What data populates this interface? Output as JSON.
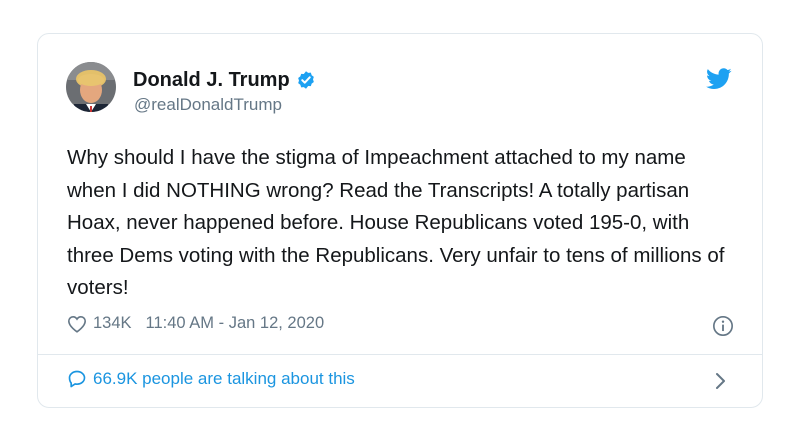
{
  "author": {
    "name": "Donald J. Trump",
    "handle": "@realDonaldTrump",
    "verified": true
  },
  "tweet": {
    "text": "Why should I have the stigma of Impeachment attached to my name when I did NOTHING wrong? Read the Transcripts! A totally partisan Hoax, never happened before. House Republicans voted 195-0, with three Dems voting with the Republicans. Very unfair to tens of millions of voters!",
    "likes": "134K",
    "timestamp": "11:40 AM - Jan 12, 2020"
  },
  "footer": {
    "talking_label": "66.9K people are talking about this"
  },
  "icons": {
    "brand": "twitter-bird-icon",
    "verified": "verified-badge-icon",
    "like": "heart-icon",
    "info": "info-icon",
    "reply": "speech-bubble-icon",
    "more": "chevron-right-icon"
  },
  "colors": {
    "accent": "#1da1f2",
    "link": "#1b95e0",
    "muted": "#657786",
    "text": "#14171a",
    "border": "#e1e8ed"
  }
}
